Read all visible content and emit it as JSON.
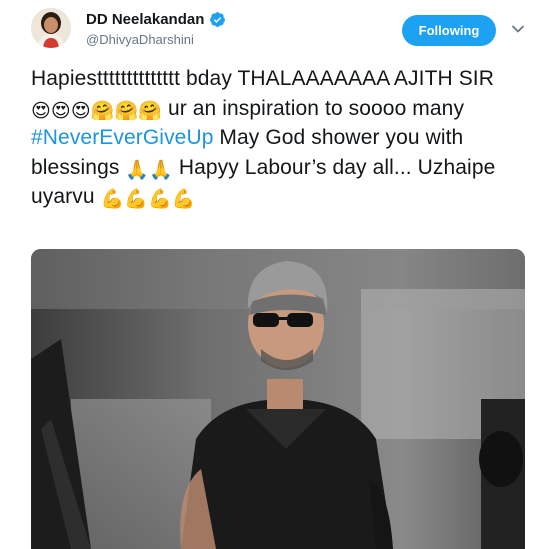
{
  "author": {
    "display_name": "DD Neelakandan",
    "handle": "@DhivyaDharshini",
    "verified": true
  },
  "actions": {
    "follow_label": "Following",
    "follow_color": "#1da1f2",
    "menu_icon": "chevron-down-icon"
  },
  "tweet": {
    "seg1": "Hapiestttttttttttttt bday THALAAAAAAA AJITH SIR ",
    "emoji_hearteyes": "😍😍😍",
    "emoji_hugs": "🤗🤗🤗",
    "seg2": " ur an inspiration to soooo many ",
    "hashtag": "#NeverEverGiveUp",
    "seg3": " May God shower you with blessings ",
    "emoji_pray": "🙏🙏",
    "seg4": " Hapyy Labour’s day all... Uzhaipe uyarvu ",
    "emoji_muscle": "💪💪💪💪",
    "hashtag_color": "#1b95e0"
  },
  "media": {
    "type": "photo",
    "subject_icon": "photo-man-sunglasses"
  }
}
